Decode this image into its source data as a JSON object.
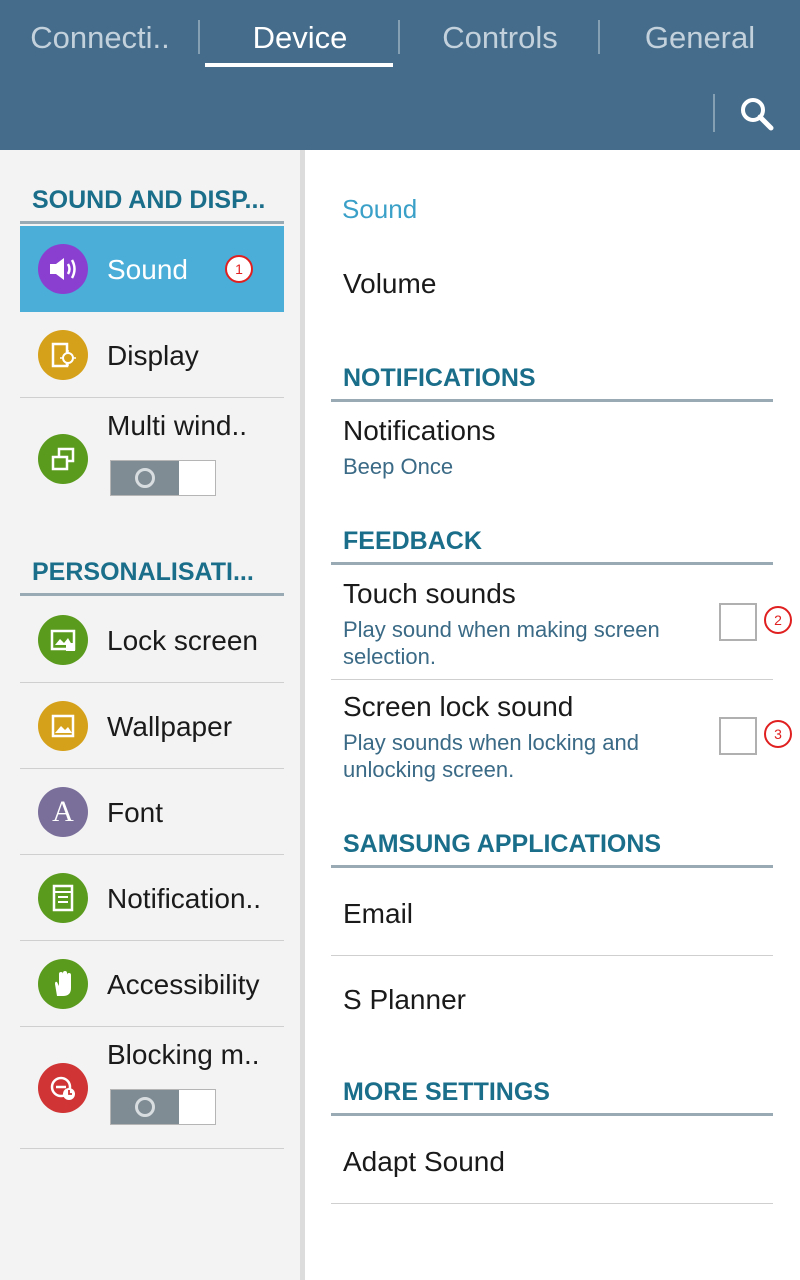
{
  "tabs": [
    {
      "label": "Connecti.."
    },
    {
      "label": "Device"
    },
    {
      "label": "Controls"
    },
    {
      "label": "General"
    }
  ],
  "active_tab": "Device",
  "icons": {
    "search": "search-icon"
  },
  "colors": {
    "topbar": "#456d8b",
    "accent": "#4aaed8",
    "header_text": "#1b6e8a"
  },
  "sidebar": {
    "section1": "SOUND AND DISP...",
    "section2": "PERSONALISATI...",
    "items": [
      {
        "label": "Sound",
        "icon": "speaker-icon",
        "color": "#8a3fd1",
        "badge": "1",
        "selected": true
      },
      {
        "label": "Display",
        "icon": "display-icon",
        "color": "#d6a11a"
      },
      {
        "label": "Multi wind..",
        "icon": "multi-window-icon",
        "color": "#5a9b1e",
        "toggle": "off"
      },
      {
        "label": "Lock screen",
        "icon": "lock-screen-icon",
        "color": "#5a9b1e"
      },
      {
        "label": "Wallpaper",
        "icon": "wallpaper-icon",
        "color": "#d6a11a"
      },
      {
        "label": "Font",
        "icon": "font-icon",
        "color": "#7a6e9b",
        "glyph": "A"
      },
      {
        "label": "Notification..",
        "icon": "notification-panel-icon",
        "color": "#5a9b1e"
      },
      {
        "label": "Accessibility",
        "icon": "hand-icon",
        "color": "#5a9b1e"
      },
      {
        "label": "Blocking m..",
        "icon": "blocking-mode-icon",
        "color": "#d03434",
        "toggle": "off"
      }
    ]
  },
  "main": {
    "title": "Sound",
    "volume": "Volume",
    "notifications_header": "NOTIFICATIONS",
    "notifications": {
      "label": "Notifications",
      "value": "Beep Once"
    },
    "feedback_header": "FEEDBACK",
    "touch_sounds": {
      "label": "Touch sounds",
      "desc": "Play sound when making screen selection.",
      "checked": false,
      "badge": "2"
    },
    "screen_lock_sound": {
      "label": "Screen lock sound",
      "desc": "Play sounds when locking and unlocking screen.",
      "checked": false,
      "badge": "3"
    },
    "samsung_header": "SAMSUNG APPLICATIONS",
    "email": "Email",
    "splanner": "S Planner",
    "more_header": "MORE SETTINGS",
    "adapt_sound": "Adapt Sound"
  }
}
